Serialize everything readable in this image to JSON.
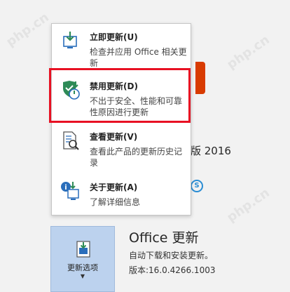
{
  "background": {
    "version_suffix": "版 2016"
  },
  "update_panel": {
    "button_label": "更新选项",
    "title": "Office 更新",
    "description": "自动下载和安装更新。",
    "version": "版本:16.0.4266.1003"
  },
  "menu": {
    "items": [
      {
        "title": "立即更新(U)",
        "desc": "检查并应用 Office 相关更新"
      },
      {
        "title": "禁用更新(D)",
        "desc": "不出于安全、性能和可靠性原因进行更新"
      },
      {
        "title": "查看更新(V)",
        "desc": "查看此产品的更新历史记录"
      },
      {
        "title": "关于更新(A)",
        "desc": "了解详细信息"
      }
    ]
  },
  "colors": {
    "highlight": "#e81123",
    "button_bg": "#bcd2ee",
    "accent_green": "#2e8b57",
    "accent_blue": "#2a6ebb"
  },
  "watermark": "php.cn"
}
